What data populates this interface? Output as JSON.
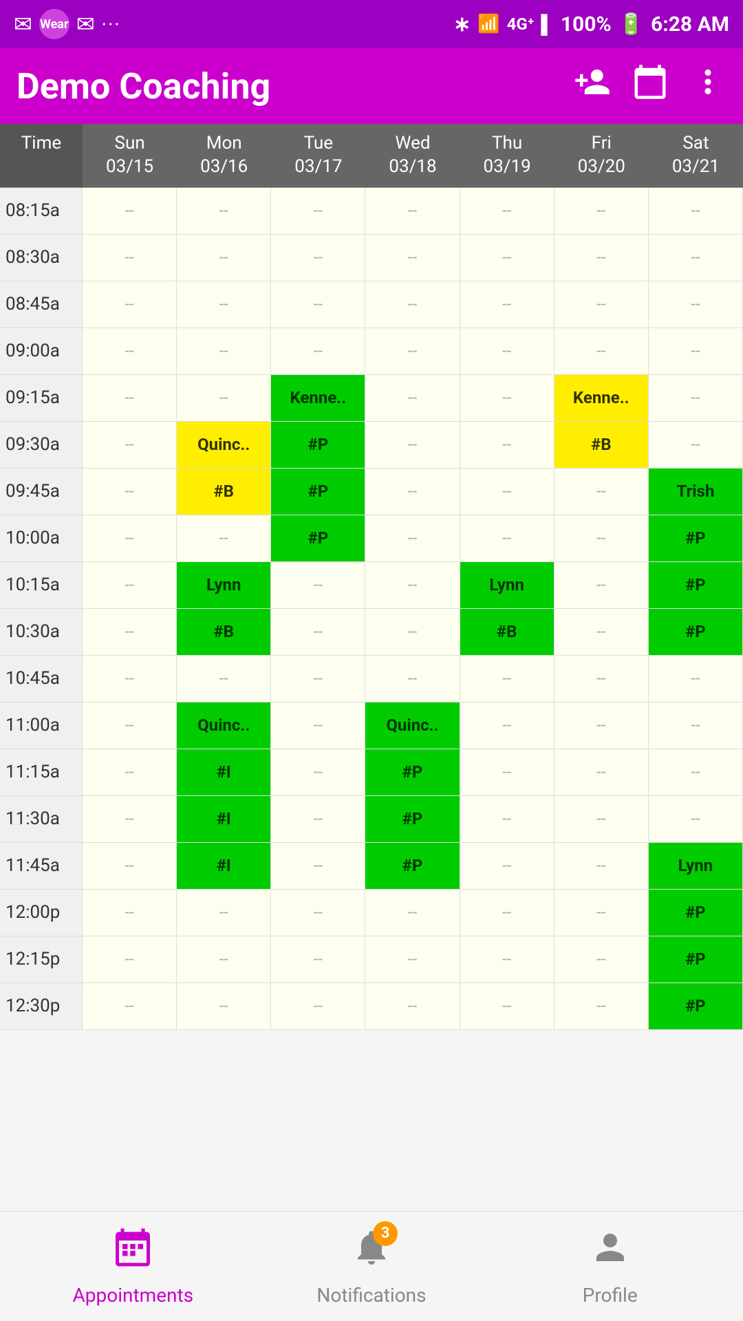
{
  "statusBar": {
    "wearText": "Wear",
    "time": "6:28 AM",
    "battery": "100%",
    "signal": "4G"
  },
  "toolbar": {
    "title": "Demo Coaching",
    "addIcon": "add-people",
    "calendarIcon": "calendar",
    "moreIcon": "more-vert"
  },
  "calendar": {
    "columns": [
      {
        "label": "Time",
        "sub": ""
      },
      {
        "label": "Sun",
        "sub": "03/15"
      },
      {
        "label": "Mon",
        "sub": "03/16"
      },
      {
        "label": "Tue",
        "sub": "03/17"
      },
      {
        "label": "Wed",
        "sub": "03/18"
      },
      {
        "label": "Thu",
        "sub": "03/19"
      },
      {
        "label": "Fri",
        "sub": "03/20"
      },
      {
        "label": "Sat",
        "sub": "03/21"
      }
    ],
    "rows": [
      {
        "time": "08:15a",
        "cells": [
          "--",
          "--",
          "--",
          "--",
          "--",
          "--",
          "--"
        ]
      },
      {
        "time": "08:30a",
        "cells": [
          "--",
          "--",
          "--",
          "--",
          "--",
          "--",
          "--"
        ]
      },
      {
        "time": "08:45a",
        "cells": [
          "--",
          "--",
          "--",
          "--",
          "--",
          "--",
          "--"
        ]
      },
      {
        "time": "09:00a",
        "cells": [
          "--",
          "--",
          "--",
          "--",
          "--",
          "--",
          "--"
        ]
      },
      {
        "time": "09:15a",
        "cells": [
          "--",
          "--",
          "Kenne..",
          "--",
          "--",
          "Kenne..",
          "--"
        ]
      },
      {
        "time": "09:30a",
        "cells": [
          "--",
          "Quinc..",
          "#P",
          "--",
          "--",
          "#B",
          "--"
        ]
      },
      {
        "time": "09:45a",
        "cells": [
          "--",
          "#B",
          "#P",
          "--",
          "--",
          "--",
          "Trish"
        ]
      },
      {
        "time": "10:00a",
        "cells": [
          "--",
          "--",
          "#P",
          "--",
          "--",
          "--",
          "#P"
        ]
      },
      {
        "time": "10:15a",
        "cells": [
          "--",
          "Lynn",
          "--",
          "--",
          "Lynn",
          "--",
          "#P"
        ]
      },
      {
        "time": "10:30a",
        "cells": [
          "--",
          "#B",
          "--",
          "--",
          "#B",
          "--",
          "#P"
        ]
      },
      {
        "time": "10:45a",
        "cells": [
          "--",
          "--",
          "--",
          "--",
          "--",
          "--",
          "--"
        ]
      },
      {
        "time": "11:00a",
        "cells": [
          "--",
          "Quinc..",
          "--",
          "Quinc..",
          "--",
          "--",
          "--"
        ]
      },
      {
        "time": "11:15a",
        "cells": [
          "--",
          "#I",
          "--",
          "#P",
          "--",
          "--",
          "--"
        ]
      },
      {
        "time": "11:30a",
        "cells": [
          "--",
          "#I",
          "--",
          "#P",
          "--",
          "--",
          "--"
        ]
      },
      {
        "time": "11:45a",
        "cells": [
          "--",
          "#I",
          "--",
          "#P",
          "--",
          "--",
          "Lynn"
        ]
      },
      {
        "time": "12:00p",
        "cells": [
          "--",
          "--",
          "--",
          "--",
          "--",
          "--",
          "#P"
        ]
      },
      {
        "time": "12:15p",
        "cells": [
          "--",
          "--",
          "--",
          "--",
          "--",
          "--",
          "#P"
        ]
      },
      {
        "time": "12:30p",
        "cells": [
          "--",
          "--",
          "--",
          "--",
          "--",
          "--",
          "#P"
        ]
      }
    ],
    "cellColors": {
      "09:15a": {
        "2": "green",
        "5": "yellow"
      },
      "09:30a": {
        "1": "yellow",
        "2": "green",
        "5": "yellow"
      },
      "09:45a": {
        "1": "yellow",
        "2": "green",
        "6": "green"
      },
      "10:00a": {
        "2": "green",
        "6": "green"
      },
      "10:15a": {
        "1": "green",
        "4": "green",
        "6": "green"
      },
      "10:30a": {
        "1": "green",
        "4": "green",
        "6": "green"
      },
      "11:00a": {
        "1": "green",
        "3": "green"
      },
      "11:15a": {
        "1": "green",
        "3": "green"
      },
      "11:30a": {
        "1": "green",
        "3": "green"
      },
      "11:45a": {
        "1": "green",
        "3": "green",
        "6": "green"
      },
      "12:00p": {
        "6": "green"
      },
      "12:15p": {
        "6": "green"
      },
      "12:30p": {
        "6": "green"
      }
    }
  },
  "bottomNav": {
    "appointments": {
      "label": "Appointments",
      "active": true
    },
    "notifications": {
      "label": "Notifications",
      "badge": "3",
      "active": false
    },
    "profile": {
      "label": "Profile",
      "active": false
    }
  }
}
